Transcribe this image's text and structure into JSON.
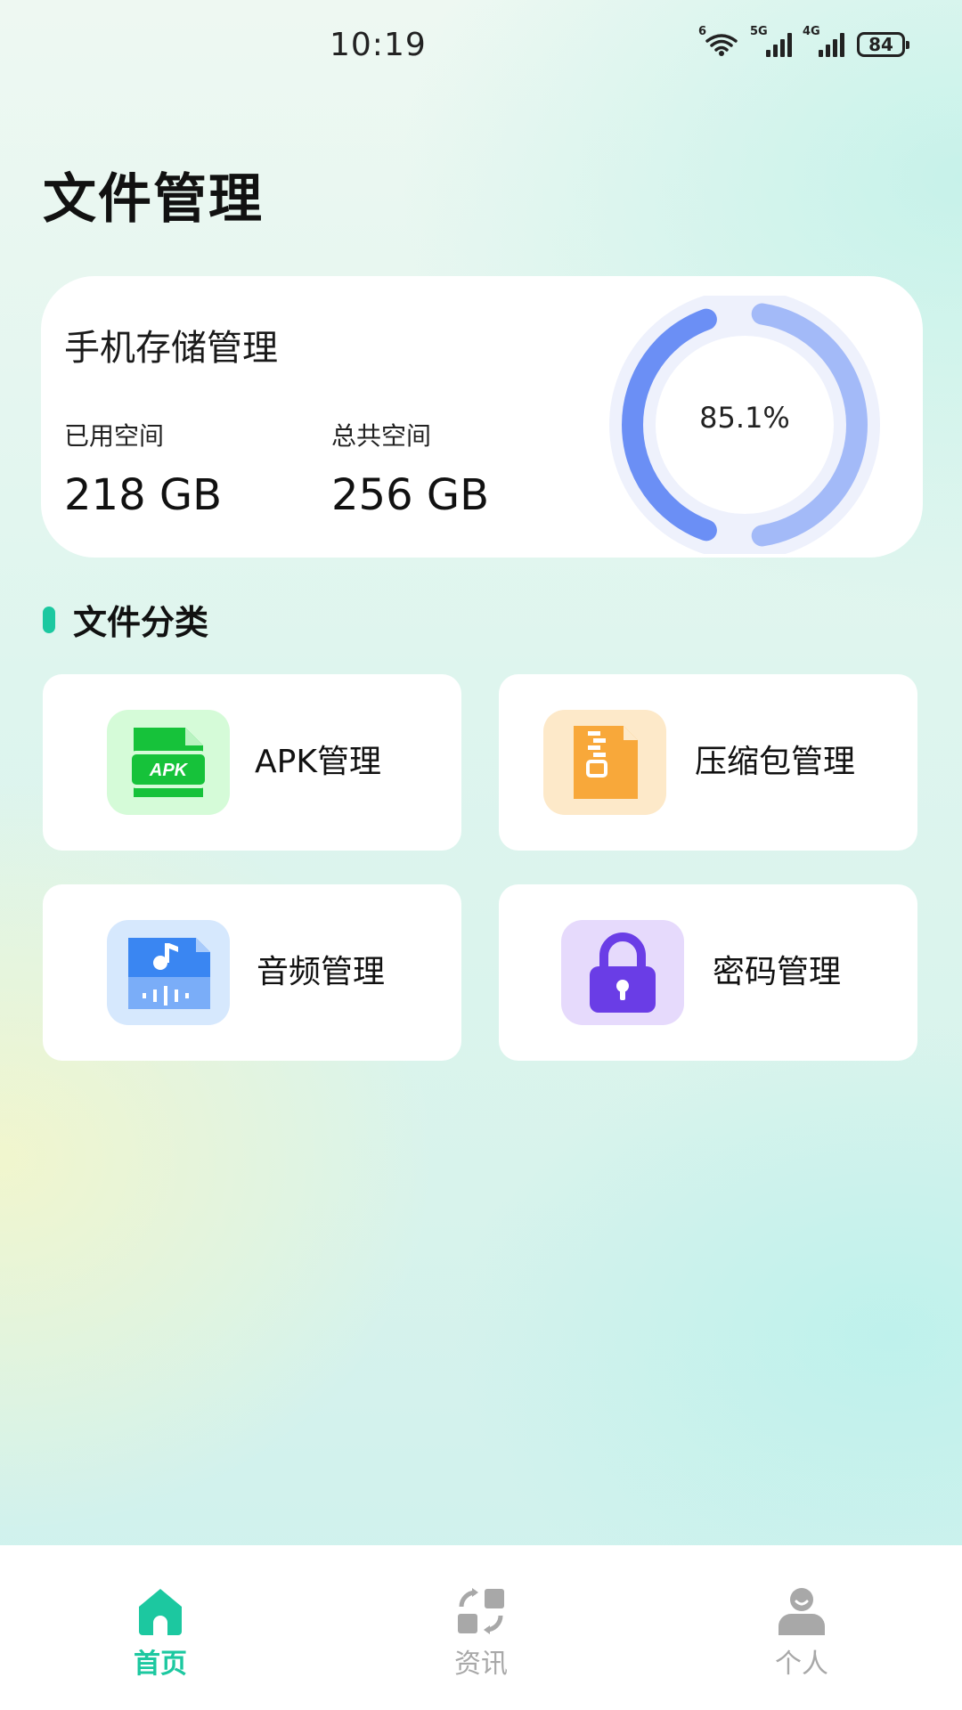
{
  "status_bar": {
    "time": "10:19",
    "wifi_label": "6",
    "signal1_label": "5G",
    "signal2_label": "4G",
    "battery": "84"
  },
  "page": {
    "title": "文件管理"
  },
  "storage": {
    "title": "手机存储管理",
    "used_label": "已用空间",
    "used_value": "218 GB",
    "total_label": "总共空间",
    "total_value": "256 GB",
    "percent_text": "85.1%",
    "percent": 0.851
  },
  "categories": {
    "title": "文件分类",
    "items": [
      {
        "label": "APK管理",
        "icon": "apk-file-icon",
        "icon_text": "APK"
      },
      {
        "label": "压缩包管理",
        "icon": "zip-file-icon"
      },
      {
        "label": "音频管理",
        "icon": "audio-file-icon"
      },
      {
        "label": "密码管理",
        "icon": "lock-icon"
      }
    ]
  },
  "nav": {
    "items": [
      {
        "label": "首页",
        "icon": "home-icon",
        "active": true
      },
      {
        "label": "资讯",
        "icon": "news-icon",
        "active": false
      },
      {
        "label": "个人",
        "icon": "person-icon",
        "active": false
      }
    ]
  },
  "colors": {
    "accent": "#1cc8a0",
    "ring_dark": "#6b8ff5",
    "ring_light": "#a3baf8",
    "nav_inactive": "#a8a8a8",
    "apk_green": "#16c23a",
    "zip_orange": "#f8a83a",
    "audio_blue": "#3a86f2",
    "lock_purple": "#6a3de6"
  }
}
